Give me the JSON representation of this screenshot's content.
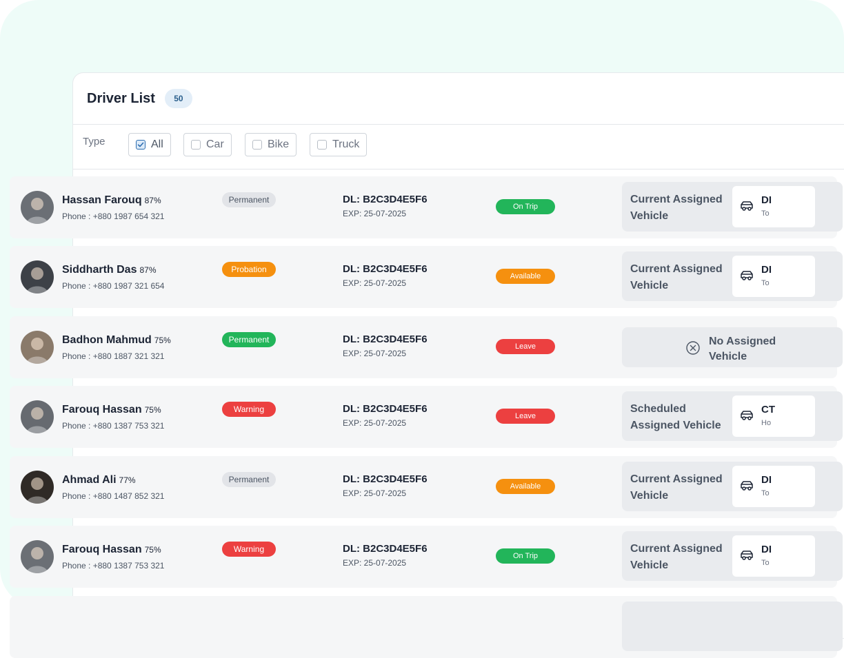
{
  "header": {
    "title": "Driver List",
    "count": "50"
  },
  "filters": {
    "label": "Type",
    "options": [
      {
        "label": "All",
        "checked": true
      },
      {
        "label": "Car",
        "checked": false
      },
      {
        "label": "Bike",
        "checked": false
      },
      {
        "label": "Truck",
        "checked": false
      }
    ]
  },
  "colors": {
    "permanent_gray": "#e2e4e8",
    "permanent_green": "#22b55a",
    "probation": "#f5900f",
    "warning": "#ec4040",
    "on_trip": "#22b55a",
    "available": "#f5900f",
    "leave": "#ec4040"
  },
  "drivers": [
    {
      "name": "Hassan Farouq",
      "score": "87%",
      "phone": "Phone : +880 1987 654 321",
      "type": "Permanent",
      "dl": "DL: B2C3D4E5F6",
      "exp": "EXP: 25-07-2025",
      "status": "On Trip",
      "vehicle_label": "Current Assigned Vehicle",
      "vehicle_code": "DI",
      "vehicle_sub": "To"
    },
    {
      "name": "Siddharth Das",
      "score": "87%",
      "phone": "Phone : +880 1987 321 654",
      "type": "Probation",
      "dl": "DL: B2C3D4E5F6",
      "exp": "EXP: 25-07-2025",
      "status": "Available",
      "vehicle_label": "Current Assigned Vehicle",
      "vehicle_code": "DI",
      "vehicle_sub": "To"
    },
    {
      "name": "Badhon Mahmud",
      "score": "75%",
      "phone": "Phone : +880 1887 321 321",
      "type": "Permanent",
      "dl": "DL: B2C3D4E5F6",
      "exp": "EXP: 25-07-2025",
      "status": "Leave",
      "vehicle_label": "No Assigned Vehicle",
      "vehicle_code": "",
      "vehicle_sub": ""
    },
    {
      "name": "Farouq Hassan",
      "score": "75%",
      "phone": "Phone : +880 1387 753 321",
      "type": "Warning",
      "dl": "DL: B2C3D4E5F6",
      "exp": "EXP: 25-07-2025",
      "status": "Leave",
      "vehicle_label": "Scheduled Assigned Vehicle",
      "vehicle_code": "CT",
      "vehicle_sub": "Ho"
    },
    {
      "name": "Ahmad Ali",
      "score": "77%",
      "phone": "Phone : +880 1487 852 321",
      "type": "Permanent",
      "dl": "DL: B2C3D4E5F6",
      "exp": "EXP: 25-07-2025",
      "status": "Available",
      "vehicle_label": "Current Assigned Vehicle",
      "vehicle_code": "DI",
      "vehicle_sub": "To"
    },
    {
      "name": "Farouq Hassan",
      "score": "75%",
      "phone": "Phone : +880 1387 753 321",
      "type": "Warning",
      "dl": "DL: B2C3D4E5F6",
      "exp": "EXP: 25-07-2025",
      "status": "On Trip",
      "vehicle_label": "Current Assigned Vehicle",
      "vehicle_code": "DI",
      "vehicle_sub": "To"
    }
  ]
}
